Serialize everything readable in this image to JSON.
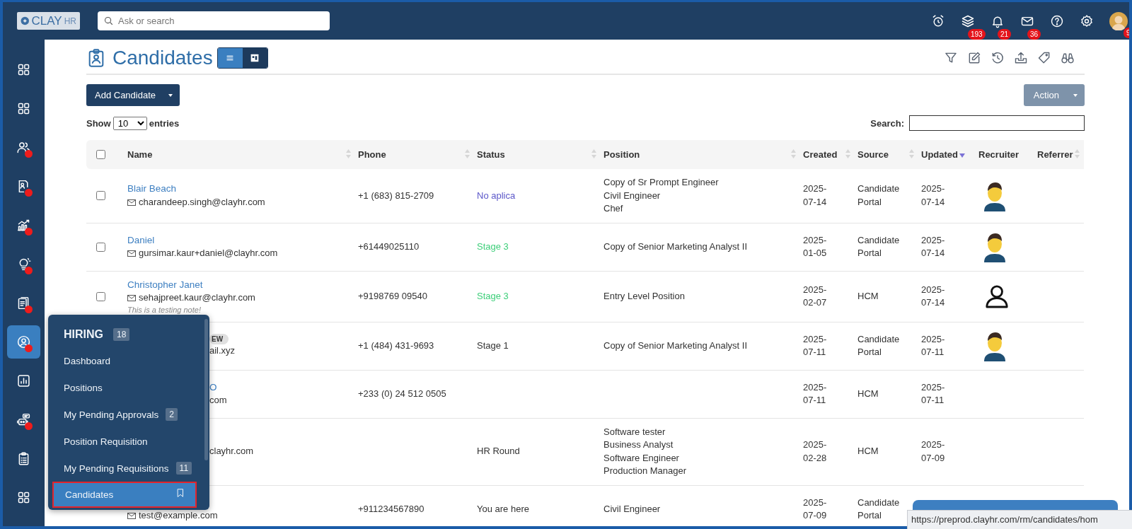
{
  "topbar": {
    "logo": "CLAY",
    "logo_suffix": "HR",
    "search": {
      "placeholder": "Ask or search"
    },
    "icons": [
      {
        "kind": "alarm"
      },
      {
        "kind": "layers",
        "badge": "193"
      },
      {
        "kind": "bell",
        "badge": "21"
      },
      {
        "kind": "mail",
        "badge": "36"
      },
      {
        "kind": "help"
      },
      {
        "kind": "settings"
      },
      {
        "kind": "avatar",
        "badge": "9"
      }
    ]
  },
  "sidebar": {
    "items": [
      {
        "kind": "grid",
        "alert": false,
        "selected": false
      },
      {
        "kind": "grid",
        "alert": false,
        "selected": false
      },
      {
        "kind": "people",
        "alert": true,
        "selected": false
      },
      {
        "kind": "docperson",
        "alert": true,
        "selected": false
      },
      {
        "kind": "growth",
        "alert": true,
        "selected": false
      },
      {
        "kind": "bulb",
        "alert": true,
        "selected": false
      },
      {
        "kind": "documents",
        "alert": true,
        "selected": false
      },
      {
        "kind": "personcircle",
        "alert": true,
        "selected": true
      },
      {
        "kind": "barchart",
        "alert": false,
        "selected": false
      },
      {
        "kind": "robot",
        "alert": true,
        "selected": false
      },
      {
        "kind": "clipboard",
        "alert": false,
        "selected": false
      },
      {
        "kind": "grid",
        "alert": false,
        "selected": false
      }
    ]
  },
  "hiring_menu": {
    "title": "HIRING",
    "count": "18",
    "items": [
      {
        "label": "Dashboard",
        "selected": false
      },
      {
        "label": "Positions",
        "selected": false
      },
      {
        "label": "My Pending Approvals",
        "count": "2",
        "selected": false
      },
      {
        "label": "Position Requisition",
        "selected": false
      },
      {
        "label": "My Pending Requisitions",
        "count": "11",
        "selected": false
      },
      {
        "label": "Candidates",
        "selected": true
      }
    ]
  },
  "page": {
    "title": "Candidates",
    "view_toggle": [
      {
        "kind": "list",
        "selected": true
      },
      {
        "kind": "board",
        "selected": false
      }
    ],
    "tools": [
      {
        "kind": "filter"
      },
      {
        "kind": "edit"
      },
      {
        "kind": "history"
      },
      {
        "kind": "upload"
      },
      {
        "kind": "tag"
      },
      {
        "kind": "binoculars"
      }
    ],
    "add_button": "Add Candidate",
    "action_button": "Action",
    "show_label": "Show",
    "entries_value": "10",
    "entries_label": "entries",
    "search_label": "Search:"
  },
  "table": {
    "header_checkbox": {
      "checked": false
    },
    "columns": [
      {
        "label": "Name",
        "kind": "sortable"
      },
      {
        "label": "Phone",
        "kind": "sortable"
      },
      {
        "label": "Status",
        "kind": "sortable"
      },
      {
        "label": "Position",
        "kind": "sortable"
      },
      {
        "label": "Created",
        "kind": "sortable"
      },
      {
        "label": "Source",
        "kind": "sortable"
      },
      {
        "label": "Updated",
        "kind": "sorted"
      },
      {
        "label": "Recruiter",
        "kind": "plain"
      },
      {
        "label": "Referrer",
        "kind": "sortable"
      }
    ],
    "rows": [
      {
        "checked": false,
        "name": "Blair Beach",
        "email": "charandeep.singh@clayhr.com",
        "phone": "+1 (683) 815-2709",
        "status": {
          "text": "No aplica",
          "color": "#5b57c9"
        },
        "positions": [
          "Copy of Sr Prompt Engineer",
          "Civil Engineer",
          "Chef"
        ],
        "created": [
          "2025-",
          "07-14"
        ],
        "source": "Candidate Portal",
        "updated": [
          "2025-",
          "07-14"
        ],
        "recruiter": {
          "kind": "avatar"
        }
      },
      {
        "checked": false,
        "name": "Daniel",
        "email": "gursimar.kaur+daniel@clayhr.com",
        "phone": "+61449025110",
        "status": {
          "text": "Stage 3",
          "color": "#3ecf7a"
        },
        "positions": [
          "Copy of Senior Marketing Analyst II"
        ],
        "created": [
          "2025-",
          "01-05"
        ],
        "source": "Candidate Portal",
        "updated": [
          "2025-",
          "07-14"
        ],
        "recruiter": {
          "kind": "avatar"
        }
      },
      {
        "checked": false,
        "name": "Christopher Janet",
        "email": "sehajpreet.kaur@clayhr.com",
        "note": "This is a testing note!",
        "phone": "+9198769 09540",
        "status": {
          "text": "Stage 3",
          "color": "#3ecf7a"
        },
        "positions": [
          "Entry Level Position"
        ],
        "created": [
          "2025-",
          "02-07"
        ],
        "source": "HCM",
        "updated": [
          "2025-",
          "07-14"
        ],
        "recruiter": {
          "kind": "placeholder"
        }
      },
      {
        "badge_visible": "EW",
        "email_visible": "ail.xyz",
        "phone": "+1 (484) 431-9693",
        "status": {
          "text": "Stage 1",
          "color": "#333333"
        },
        "positions": [
          "Copy of Senior Marketing Analyst II"
        ],
        "created": [
          "2025-",
          "07-11"
        ],
        "source": "Candidate Portal",
        "updated": [
          "2025-",
          "07-11"
        ],
        "recruiter": {
          "kind": "avatar"
        }
      },
      {
        "name_visible": "O",
        "email_visible": "com",
        "phone": "+233 (0) 24 512 0505",
        "created": [
          "2025-",
          "07-11"
        ],
        "source": "HCM",
        "updated": [
          "2025-",
          "07-11"
        ]
      },
      {
        "email_visible": "clayhr.com",
        "status": {
          "text": "HR Round",
          "color": "#333333"
        },
        "positions": [
          "Software tester",
          "Business Analyst",
          "Software Engineer",
          "Production Manager"
        ],
        "created": [
          "2025-",
          "02-28"
        ],
        "source": "HCM",
        "updated": [
          "2025-",
          "07-09"
        ]
      },
      {
        "email": "test@example.com",
        "phone": "+911234567890",
        "status": {
          "text": "You are here",
          "color": "#333333"
        },
        "positions": [
          "Civil Engineer"
        ],
        "created": [
          "2025-",
          "07-09"
        ],
        "source": "Candidate Portal"
      }
    ]
  },
  "status_url": "https://preprod.clayhr.com/rm/candidates/hom"
}
